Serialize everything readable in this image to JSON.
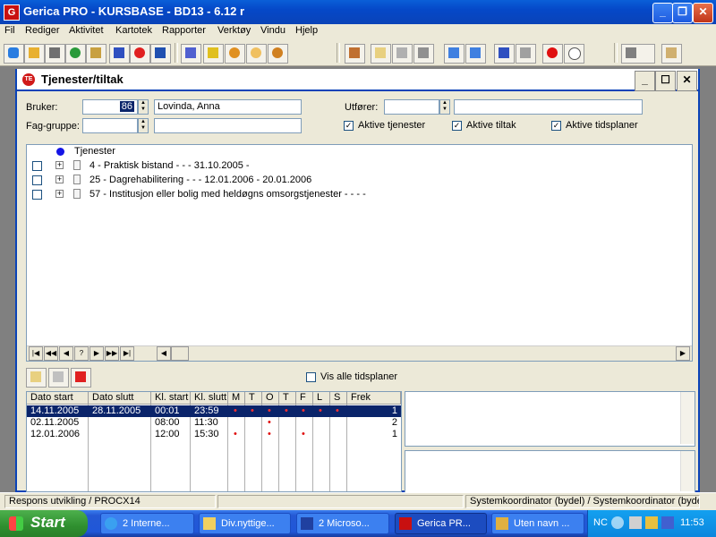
{
  "app": {
    "title": "Gerica PRO - KURSBASE - BD13 - 6.12 r",
    "icon_letter": "G"
  },
  "menu": [
    "Fil",
    "Rediger",
    "Aktivitet",
    "Kartotek",
    "Rapporter",
    "Verktøy",
    "Vindu",
    "Hjelp"
  ],
  "child": {
    "title": "Tjenester/tiltak",
    "icon_text": "TE",
    "form": {
      "bruker_label": "Bruker:",
      "bruker_id": "86",
      "bruker_name": "Lovinda, Anna",
      "faggruppe_label": "Fag-gruppe:",
      "utforer_label": "Utfører:",
      "chk_aktive_tjenester": "Aktive tjenester",
      "chk_aktive_tiltak": "Aktive tiltak",
      "chk_aktive_tidsplaner": "Aktive tidsplaner"
    },
    "tree": {
      "root": "Tjenester",
      "items": [
        "4 - Praktisk bistand -  -  - 31.10.2005 -",
        "25 - Dagrehabilitering -  -  - 12.01.2006 - 20.01.2006",
        "57 - Institusjon eller bolig med heldøgns omsorgstjenester -  -  -                    -"
      ]
    },
    "vis_alle": "Vis alle tidsplaner",
    "grid": {
      "headers": [
        "Dato start",
        "Dato slutt",
        "Kl. start",
        "Kl. slutt",
        "M",
        "T",
        "O",
        "T",
        "F",
        "L",
        "S",
        "Frek"
      ],
      "rows": [
        {
          "dato_start": "14.11.2005",
          "dato_slutt": "28.11.2005",
          "kl_start": "00:01",
          "kl_slutt": "23:59",
          "days": [
            "•",
            "•",
            "•",
            "•",
            "•",
            "•",
            "•"
          ],
          "frek": "1",
          "selected": true
        },
        {
          "dato_start": "02.11.2005",
          "dato_slutt": "",
          "kl_start": "08:00",
          "kl_slutt": "11:30",
          "days": [
            "",
            "",
            "•",
            "",
            "",
            "",
            ""
          ],
          "frek": "2",
          "selected": false
        },
        {
          "dato_start": "12.01.2006",
          "dato_slutt": "",
          "kl_start": "12:00",
          "kl_slutt": "15:30",
          "days": [
            "•",
            "",
            "•",
            "",
            "•",
            "",
            ""
          ],
          "frek": "1",
          "selected": false
        }
      ]
    }
  },
  "status": {
    "left": "Respons utvikling / PROCX14",
    "right": "Systemkoordinator (bydel) / Systemkoordinator (bydel)"
  },
  "taskbar": {
    "start": "Start",
    "tasks": [
      "2 Interne...",
      "Div.nyttige...",
      "2 Microso...",
      "Gerica PR...",
      "Uten navn ..."
    ],
    "tray_text": "NC",
    "clock": "11:53"
  },
  "colors": {
    "accent": "#0a43b8",
    "selection": "#0a246a",
    "dot": "#e01010"
  }
}
